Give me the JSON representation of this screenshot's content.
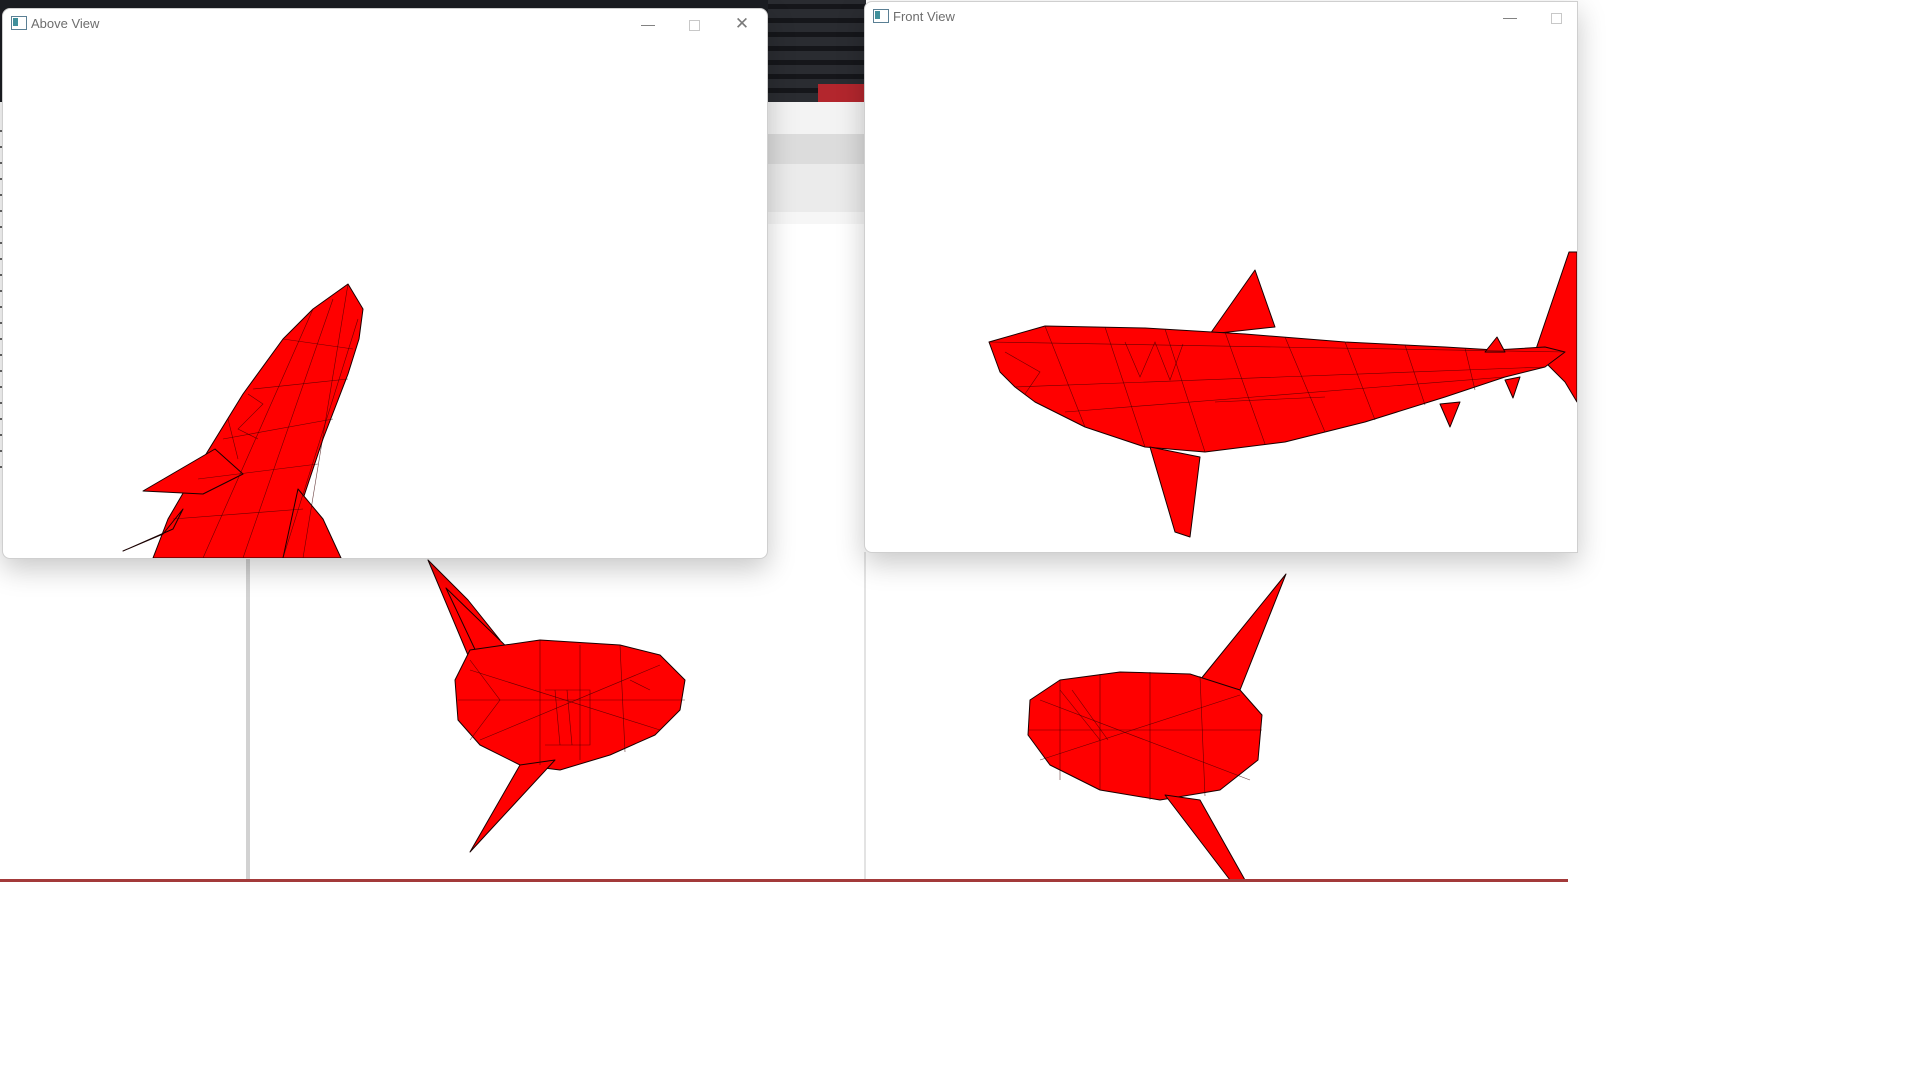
{
  "windows": {
    "above": {
      "title": "Above View",
      "controls": {
        "minimize": "—",
        "close": "✕"
      }
    },
    "front": {
      "title": "Front View",
      "controls": {
        "minimize": "—"
      }
    }
  },
  "scene": {
    "model_color": "#ff0000",
    "edge_color": "#1a0000"
  }
}
